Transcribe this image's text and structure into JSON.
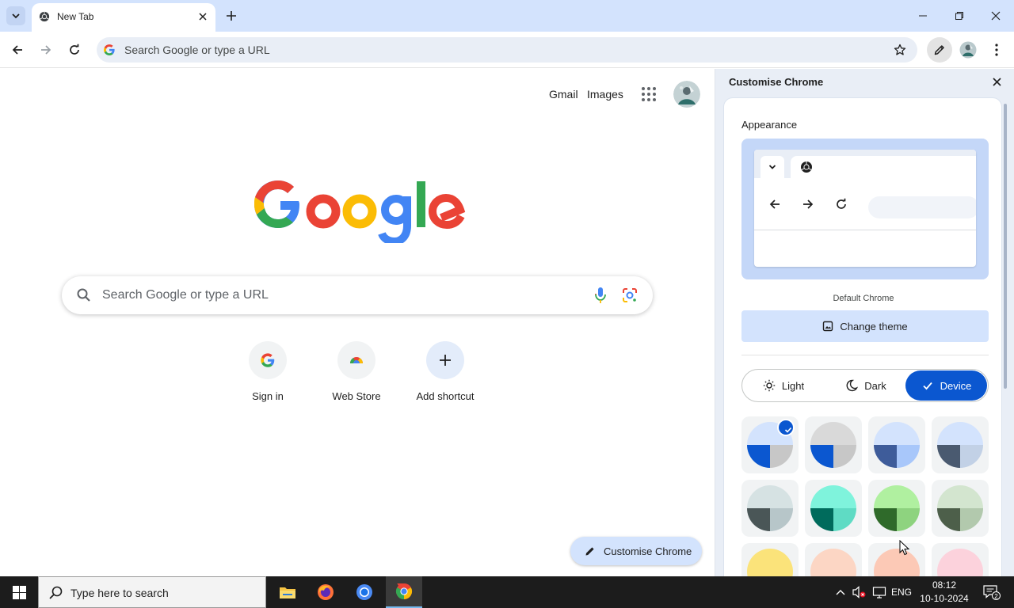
{
  "browser": {
    "tab_title": "New Tab",
    "omnibox_placeholder": "Search Google or type a URL"
  },
  "ntp": {
    "links": {
      "gmail": "Gmail",
      "images": "Images"
    },
    "search_placeholder": "Search Google or type a URL",
    "shortcuts": [
      {
        "label": "Sign in",
        "icon": "google-g-icon"
      },
      {
        "label": "Web Store",
        "icon": "web-store-icon"
      },
      {
        "label": "Add shortcut",
        "icon": "plus-icon"
      }
    ],
    "customise_button": "Customise Chrome"
  },
  "side_panel": {
    "title": "Customise Chrome",
    "appearance_heading": "Appearance",
    "theme_name": "Default Chrome",
    "change_theme_label": "Change theme",
    "modes": {
      "light": "Light",
      "dark": "Dark",
      "device": "Device"
    },
    "selected_mode": "Device",
    "color_swatches": [
      {
        "top": "#d3e3fd",
        "left": "#0b57d0",
        "right": "#c7c7c7",
        "selected": true
      },
      {
        "top": "#d9d9d9",
        "left": "#0b57d0",
        "right": "#c7c7c7",
        "selected": false
      },
      {
        "top": "#d3e3fd",
        "left": "#3e5c9a",
        "right": "#a8c7fa",
        "selected": false
      },
      {
        "top": "#d3e3fd",
        "left": "#4a5a70",
        "right": "#c2d1e6",
        "selected": false
      },
      {
        "top": "#d6e2e3",
        "left": "#4a5657",
        "right": "#b7c6c9",
        "selected": false
      },
      {
        "top": "#7ff3dc",
        "left": "#006b5c",
        "right": "#5fdbc4",
        "selected": false
      },
      {
        "top": "#b0f0a0",
        "left": "#2f6a2a",
        "right": "#8ed37f",
        "selected": false
      },
      {
        "top": "#d3e5cf",
        "left": "#4d5f4a",
        "right": "#b2c9ad",
        "selected": false
      },
      {
        "top": "#fbe37a",
        "left": "#fbe37a",
        "right": "#fbe37a",
        "selected": false
      },
      {
        "top": "#fcd6c4",
        "left": "#fcd6c4",
        "right": "#fcd6c4",
        "selected": false
      },
      {
        "top": "#fcc9b6",
        "left": "#fcc9b6",
        "right": "#fcc9b6",
        "selected": false
      },
      {
        "top": "#fcd2dc",
        "left": "#fcd2dc",
        "right": "#fcd2dc",
        "selected": false
      }
    ]
  },
  "taskbar": {
    "search_placeholder": "Type here to search",
    "language": "ENG",
    "time": "08:12",
    "date": "10-10-2024",
    "notification_count": "2"
  },
  "colors": {
    "accent": "#0b57d0",
    "tabstrip": "#d3e3fd",
    "panel": "#e9eef6",
    "taskbar": "#1c1c1c"
  }
}
